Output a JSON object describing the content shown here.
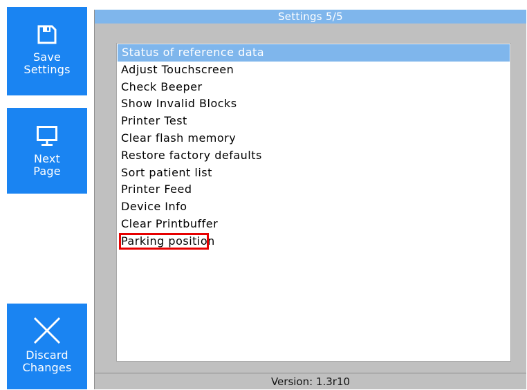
{
  "sidebar": {
    "save": {
      "label": "Save\nSettings",
      "icon": "floppy-disk-icon"
    },
    "next": {
      "label": "Next\nPage",
      "icon": "monitor-icon"
    },
    "discard": {
      "label": "Discard\nChanges",
      "icon": "close-icon"
    }
  },
  "panel": {
    "title": "Settings 5/5",
    "items": [
      {
        "label": "Status of reference data",
        "selected": true
      },
      {
        "label": "Adjust Touchscreen"
      },
      {
        "label": "Check Beeper"
      },
      {
        "label": "Show Invalid Blocks"
      },
      {
        "label": "Printer Test"
      },
      {
        "label": "Clear flash memory"
      },
      {
        "label": "Restore factory defaults"
      },
      {
        "label": "Sort patient list"
      },
      {
        "label": "Printer Feed"
      },
      {
        "label": "Device Info"
      },
      {
        "label": "Clear Printbuffer"
      },
      {
        "label": "Parking position",
        "highlighted": true
      }
    ],
    "footer": "Version: 1.3r10"
  },
  "colors": {
    "button_blue": "#1a84f2",
    "title_bar": "#7fb6ec",
    "selection": "#7fb6ec",
    "panel_gray": "#c0c0c0",
    "highlight_red": "#e60000"
  }
}
